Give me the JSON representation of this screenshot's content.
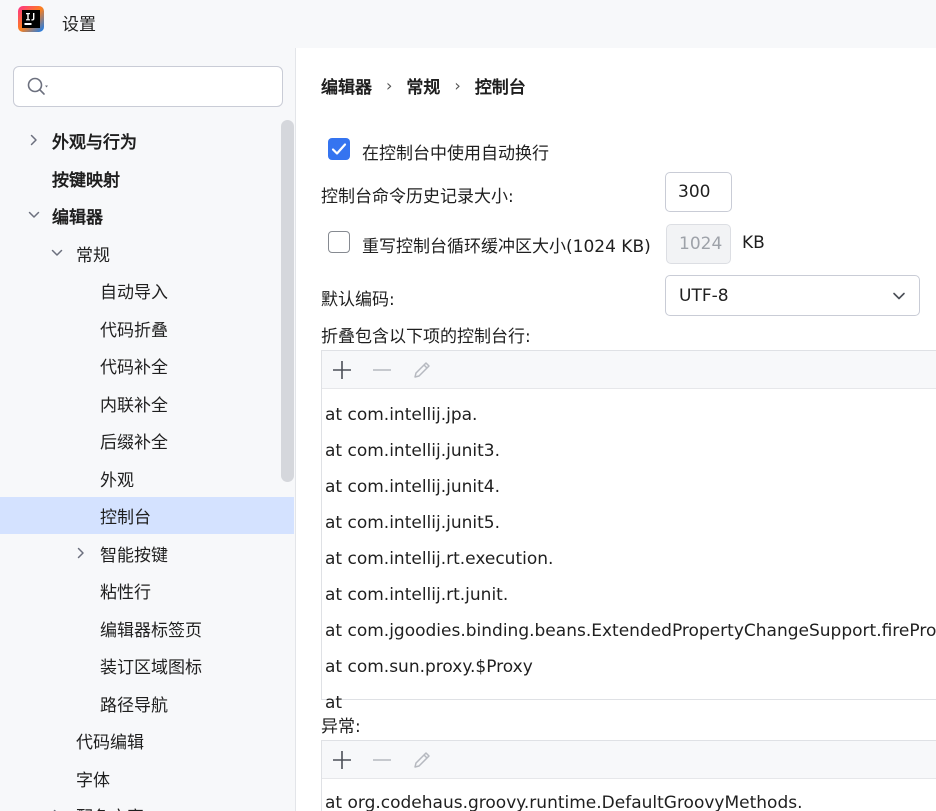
{
  "window": {
    "title": "设置"
  },
  "search": {
    "placeholder": ""
  },
  "tree": [
    {
      "label": "外观与行为",
      "bold": true,
      "level": 0,
      "chevron": "right"
    },
    {
      "label": "按键映射",
      "bold": true,
      "level": 0,
      "chevron": "none"
    },
    {
      "label": "编辑器",
      "bold": true,
      "level": 0,
      "chevron": "down"
    },
    {
      "label": "常规",
      "bold": false,
      "level": 1,
      "chevron": "down"
    },
    {
      "label": "自动导入",
      "bold": false,
      "level": 2,
      "chevron": "none"
    },
    {
      "label": "代码折叠",
      "bold": false,
      "level": 2,
      "chevron": "none"
    },
    {
      "label": "代码补全",
      "bold": false,
      "level": 2,
      "chevron": "none"
    },
    {
      "label": "内联补全",
      "bold": false,
      "level": 2,
      "chevron": "none"
    },
    {
      "label": "后缀补全",
      "bold": false,
      "level": 2,
      "chevron": "none"
    },
    {
      "label": "外观",
      "bold": false,
      "level": 2,
      "chevron": "none"
    },
    {
      "label": "控制台",
      "bold": false,
      "level": 2,
      "chevron": "none",
      "selected": true
    },
    {
      "label": "智能按键",
      "bold": false,
      "level": 2,
      "chevron": "right"
    },
    {
      "label": "粘性行",
      "bold": false,
      "level": 2,
      "chevron": "none"
    },
    {
      "label": "编辑器标签页",
      "bold": false,
      "level": 2,
      "chevron": "none"
    },
    {
      "label": "装订区域图标",
      "bold": false,
      "level": 2,
      "chevron": "none"
    },
    {
      "label": "路径导航",
      "bold": false,
      "level": 2,
      "chevron": "none"
    },
    {
      "label": "代码编辑",
      "bold": false,
      "level": 1,
      "chevron": "none"
    },
    {
      "label": "字体",
      "bold": false,
      "level": 1,
      "chevron": "none"
    },
    {
      "label": "配色方案",
      "bold": false,
      "level": 1,
      "chevron": "right"
    }
  ],
  "breadcrumb": {
    "part1": "编辑器",
    "part2": "常规",
    "part3": "控制台",
    "sep": "›"
  },
  "settings": {
    "soft_wrap_label": "在控制台中使用自动换行",
    "soft_wrap_checked": true,
    "history_label": "控制台命令历史记录大小:",
    "history_value": "300",
    "override_buffer_label": "重写控制台循环缓冲区大小(1024 KB)",
    "override_buffer_checked": false,
    "buffer_value": "1024",
    "buffer_unit": "KB",
    "encoding_label": "默认编码:",
    "encoding_value": "UTF-8",
    "fold_label": "折叠包含以下项的控制台行:",
    "exceptions_label": "异常:"
  },
  "fold_lines": [
    "at com.intellij.jpa.",
    "at com.intellij.junit3.",
    "at com.intellij.junit4.",
    "at com.intellij.junit5.",
    "at com.intellij.rt.execution.",
    "at com.intellij.rt.junit.",
    "at com.jgoodies.binding.beans.ExtendedPropertyChangeSupport.firePropertyChange",
    "at com.sun.proxy.$Proxy",
    "at"
  ],
  "exception_lines": [
    "at org.codehaus.groovy.runtime.DefaultGroovyMethods."
  ],
  "colors": {
    "accent": "#3574f0",
    "selection": "#d4e2ff",
    "logo_pink": "#ff318c",
    "logo_orange": "#fc801d",
    "logo_blue": "#087cfa"
  }
}
